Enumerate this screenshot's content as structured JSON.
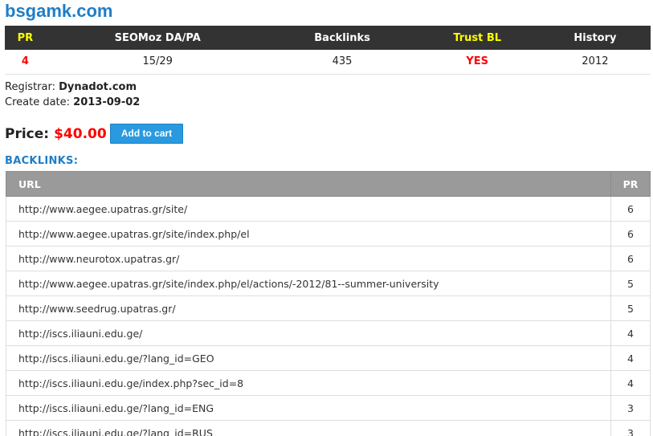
{
  "domain": "bsgamk.com",
  "stats": {
    "headers": [
      "PR",
      "SEOMoz DA/PA",
      "Backlinks",
      "Trust BL",
      "History"
    ],
    "values": [
      "4",
      "15/29",
      "435",
      "YES",
      "2012"
    ]
  },
  "meta": {
    "registrar_label": "Registrar:",
    "registrar_value": "Dynadot.com",
    "create_label": "Create date:",
    "create_value": "2013-09-02"
  },
  "price": {
    "label": "Price:",
    "value": "$40.00",
    "button": "Add to cart"
  },
  "backlinks": {
    "title": "BACKLINKS:",
    "columns": [
      "URL",
      "PR"
    ],
    "rows": [
      {
        "url": "http://www.aegee.upatras.gr/site/",
        "pr": "6"
      },
      {
        "url": "http://www.aegee.upatras.gr/site/index.php/el",
        "pr": "6"
      },
      {
        "url": "http://www.neurotox.upatras.gr/",
        "pr": "6"
      },
      {
        "url": "http://www.aegee.upatras.gr/site/index.php/el/actions/-2012/81--summer-university",
        "pr": "5"
      },
      {
        "url": "http://www.seedrug.upatras.gr/",
        "pr": "5"
      },
      {
        "url": "http://iscs.iliauni.edu.ge/",
        "pr": "4"
      },
      {
        "url": "http://iscs.iliauni.edu.ge/?lang_id=GEO",
        "pr": "4"
      },
      {
        "url": "http://iscs.iliauni.edu.ge/index.php?sec_id=8",
        "pr": "4"
      },
      {
        "url": "http://iscs.iliauni.edu.ge/?lang_id=ENG",
        "pr": "3"
      },
      {
        "url": "http://iscs.iliauni.edu.ge/?lang_id=RUS",
        "pr": "3"
      }
    ]
  },
  "colors": {
    "accent_blue": "#1e7ec8",
    "header_dark": "#333333",
    "highlight_yellow": "#ffff00",
    "value_red": "#ff0000",
    "button_blue": "#2a9ae0",
    "table_header_gray": "#9a9a9a"
  }
}
